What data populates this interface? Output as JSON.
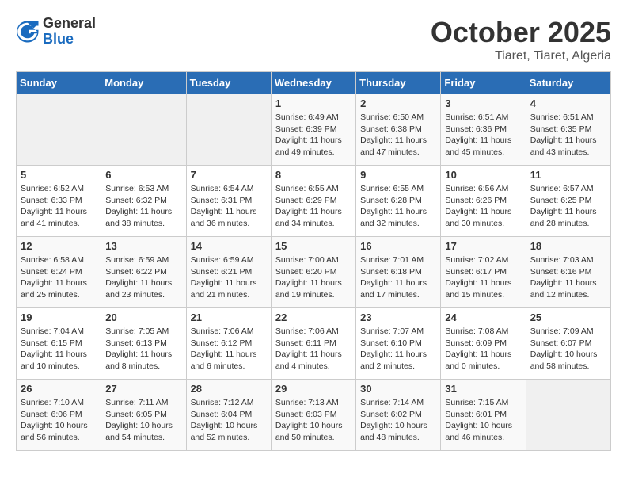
{
  "logo": {
    "general": "General",
    "blue": "Blue"
  },
  "header": {
    "month": "October 2025",
    "location": "Tiaret, Tiaret, Algeria"
  },
  "weekdays": [
    "Sunday",
    "Monday",
    "Tuesday",
    "Wednesday",
    "Thursday",
    "Friday",
    "Saturday"
  ],
  "weeks": [
    [
      {
        "day": "",
        "info": ""
      },
      {
        "day": "",
        "info": ""
      },
      {
        "day": "",
        "info": ""
      },
      {
        "day": "1",
        "info": "Sunrise: 6:49 AM\nSunset: 6:39 PM\nDaylight: 11 hours and 49 minutes."
      },
      {
        "day": "2",
        "info": "Sunrise: 6:50 AM\nSunset: 6:38 PM\nDaylight: 11 hours and 47 minutes."
      },
      {
        "day": "3",
        "info": "Sunrise: 6:51 AM\nSunset: 6:36 PM\nDaylight: 11 hours and 45 minutes."
      },
      {
        "day": "4",
        "info": "Sunrise: 6:51 AM\nSunset: 6:35 PM\nDaylight: 11 hours and 43 minutes."
      }
    ],
    [
      {
        "day": "5",
        "info": "Sunrise: 6:52 AM\nSunset: 6:33 PM\nDaylight: 11 hours and 41 minutes."
      },
      {
        "day": "6",
        "info": "Sunrise: 6:53 AM\nSunset: 6:32 PM\nDaylight: 11 hours and 38 minutes."
      },
      {
        "day": "7",
        "info": "Sunrise: 6:54 AM\nSunset: 6:31 PM\nDaylight: 11 hours and 36 minutes."
      },
      {
        "day": "8",
        "info": "Sunrise: 6:55 AM\nSunset: 6:29 PM\nDaylight: 11 hours and 34 minutes."
      },
      {
        "day": "9",
        "info": "Sunrise: 6:55 AM\nSunset: 6:28 PM\nDaylight: 11 hours and 32 minutes."
      },
      {
        "day": "10",
        "info": "Sunrise: 6:56 AM\nSunset: 6:26 PM\nDaylight: 11 hours and 30 minutes."
      },
      {
        "day": "11",
        "info": "Sunrise: 6:57 AM\nSunset: 6:25 PM\nDaylight: 11 hours and 28 minutes."
      }
    ],
    [
      {
        "day": "12",
        "info": "Sunrise: 6:58 AM\nSunset: 6:24 PM\nDaylight: 11 hours and 25 minutes."
      },
      {
        "day": "13",
        "info": "Sunrise: 6:59 AM\nSunset: 6:22 PM\nDaylight: 11 hours and 23 minutes."
      },
      {
        "day": "14",
        "info": "Sunrise: 6:59 AM\nSunset: 6:21 PM\nDaylight: 11 hours and 21 minutes."
      },
      {
        "day": "15",
        "info": "Sunrise: 7:00 AM\nSunset: 6:20 PM\nDaylight: 11 hours and 19 minutes."
      },
      {
        "day": "16",
        "info": "Sunrise: 7:01 AM\nSunset: 6:18 PM\nDaylight: 11 hours and 17 minutes."
      },
      {
        "day": "17",
        "info": "Sunrise: 7:02 AM\nSunset: 6:17 PM\nDaylight: 11 hours and 15 minutes."
      },
      {
        "day": "18",
        "info": "Sunrise: 7:03 AM\nSunset: 6:16 PM\nDaylight: 11 hours and 12 minutes."
      }
    ],
    [
      {
        "day": "19",
        "info": "Sunrise: 7:04 AM\nSunset: 6:15 PM\nDaylight: 11 hours and 10 minutes."
      },
      {
        "day": "20",
        "info": "Sunrise: 7:05 AM\nSunset: 6:13 PM\nDaylight: 11 hours and 8 minutes."
      },
      {
        "day": "21",
        "info": "Sunrise: 7:06 AM\nSunset: 6:12 PM\nDaylight: 11 hours and 6 minutes."
      },
      {
        "day": "22",
        "info": "Sunrise: 7:06 AM\nSunset: 6:11 PM\nDaylight: 11 hours and 4 minutes."
      },
      {
        "day": "23",
        "info": "Sunrise: 7:07 AM\nSunset: 6:10 PM\nDaylight: 11 hours and 2 minutes."
      },
      {
        "day": "24",
        "info": "Sunrise: 7:08 AM\nSunset: 6:09 PM\nDaylight: 11 hours and 0 minutes."
      },
      {
        "day": "25",
        "info": "Sunrise: 7:09 AM\nSunset: 6:07 PM\nDaylight: 10 hours and 58 minutes."
      }
    ],
    [
      {
        "day": "26",
        "info": "Sunrise: 7:10 AM\nSunset: 6:06 PM\nDaylight: 10 hours and 56 minutes."
      },
      {
        "day": "27",
        "info": "Sunrise: 7:11 AM\nSunset: 6:05 PM\nDaylight: 10 hours and 54 minutes."
      },
      {
        "day": "28",
        "info": "Sunrise: 7:12 AM\nSunset: 6:04 PM\nDaylight: 10 hours and 52 minutes."
      },
      {
        "day": "29",
        "info": "Sunrise: 7:13 AM\nSunset: 6:03 PM\nDaylight: 10 hours and 50 minutes."
      },
      {
        "day": "30",
        "info": "Sunrise: 7:14 AM\nSunset: 6:02 PM\nDaylight: 10 hours and 48 minutes."
      },
      {
        "day": "31",
        "info": "Sunrise: 7:15 AM\nSunset: 6:01 PM\nDaylight: 10 hours and 46 minutes."
      },
      {
        "day": "",
        "info": ""
      }
    ]
  ]
}
